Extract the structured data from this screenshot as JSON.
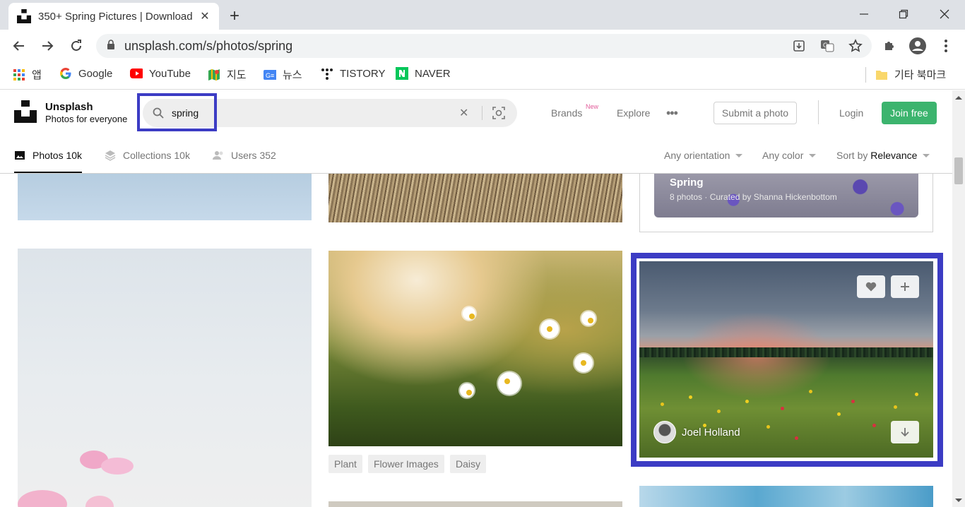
{
  "browser": {
    "tab_title": "350+ Spring Pictures | Download",
    "url": "unsplash.com/s/photos/spring",
    "bookmarks": [
      {
        "label": "앱",
        "icon": "apps-grid-icon"
      },
      {
        "label": "Google",
        "icon": "google-icon"
      },
      {
        "label": "YouTube",
        "icon": "youtube-icon"
      },
      {
        "label": "지도",
        "icon": "maps-icon"
      },
      {
        "label": "뉴스",
        "icon": "news-icon"
      },
      {
        "label": "TISTORY",
        "icon": "tistory-icon"
      },
      {
        "label": "NAVER",
        "icon": "naver-icon"
      }
    ],
    "other_bookmarks": "기타 북마크"
  },
  "header": {
    "brand_name": "Unsplash",
    "brand_tagline": "Photos for everyone",
    "search_value": "spring",
    "nav": {
      "brands": "Brands",
      "brands_badge": "New",
      "explore": "Explore",
      "more": "•••"
    },
    "submit_label": "Submit a photo",
    "login_label": "Login",
    "join_label": "Join free"
  },
  "filters": {
    "tabs": [
      {
        "label": "Photos 10k",
        "active": true
      },
      {
        "label": "Collections 10k",
        "active": false
      },
      {
        "label": "Users 352",
        "active": false
      }
    ],
    "orientation": "Any orientation",
    "color": "Any color",
    "sort_prefix": "Sort by",
    "sort_value": "Relevance"
  },
  "grid": {
    "collection": {
      "title": "Spring",
      "subtitle": "8 photos · Curated by Shanna Hickenbottom"
    },
    "tags": [
      "Plant",
      "Flower Images",
      "Daisy"
    ],
    "featured_photo": {
      "author": "Joel Holland"
    }
  },
  "colors": {
    "accent_green": "#3cb46e",
    "highlight_blue": "#3c3cc4",
    "new_badge": "#e25c9a"
  }
}
